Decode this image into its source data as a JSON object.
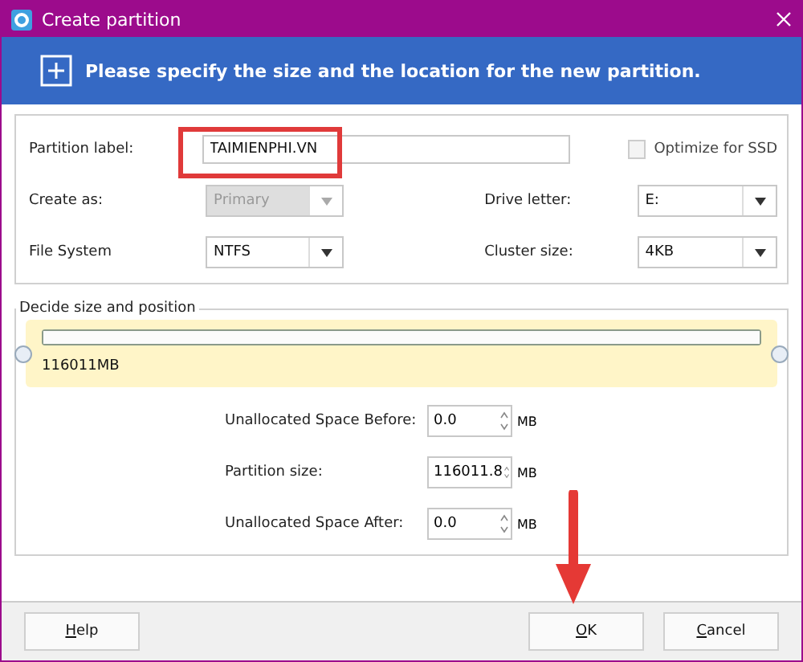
{
  "window": {
    "title": "Create partition"
  },
  "header": {
    "text": "Please specify the size and the location for the new partition."
  },
  "partition_label": {
    "label": "Partition label:",
    "value": "TAIMIENPHI.VN"
  },
  "optimize_ssd": {
    "label": "Optimize for SSD",
    "checked": false,
    "disabled": true
  },
  "selects": [
    {
      "label": "Create as:",
      "value": "Primary",
      "disabled": true
    },
    {
      "label": "Drive letter:",
      "value": "E:",
      "disabled": false
    },
    {
      "label": "File System",
      "value": "NTFS",
      "disabled": false
    },
    {
      "label": "Cluster size:",
      "value": "4KB",
      "disabled": false
    }
  ],
  "size_section": {
    "legend": "Decide size and position",
    "partition_size_text": "116011MB",
    "level": 1
  },
  "spinners": [
    {
      "label": "Unallocated Space Before:",
      "value": "0.0",
      "unit": "MB"
    },
    {
      "label": "Partition size:",
      "value": "116011.8",
      "unit": "MB"
    },
    {
      "label": "Unallocated Space After:",
      "value": "0.0",
      "unit": "MB"
    }
  ],
  "buttons": [
    {
      "label": "Help"
    },
    {
      "label": "OK"
    },
    {
      "label": "Cancel"
    }
  ]
}
